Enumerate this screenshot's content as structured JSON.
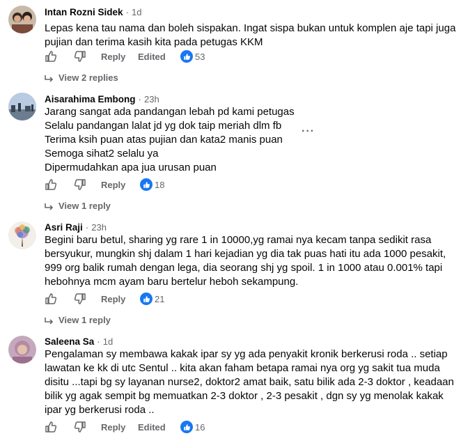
{
  "comments": [
    {
      "author": "Intan Rozni Sidek",
      "time": "1d",
      "lines": [
        "Lepas kena tau nama dan boleh sispakan. Ingat sispa bukan untuk komplen aje tapi juga",
        "pujian dan terima kasih kita pada petugas KKM"
      ],
      "reply_label": "Reply",
      "edited_label": "Edited",
      "like_count": "53",
      "view_replies": "View 2 replies"
    },
    {
      "author": "Aisarahima Embong",
      "time": "23h",
      "lines": [
        "Jarang sangat ada pandangan lebah pd kami petugas",
        "Selalu pandangan lalat jd yg dok taip meriah dlm fb",
        "Terima ksih puan atas pujian dan kata2 manis puan",
        "Semoga sihat2 selalu ya",
        "Dipermudahkan apa jua urusan puan"
      ],
      "reply_label": "Reply",
      "like_count": "18",
      "view_replies": "View 1 reply",
      "more_label": "···"
    },
    {
      "author": "Asri Raji",
      "time": "23h",
      "lines": [
        "Begini baru betul, sharing yg rare 1 in 10000,yg ramai nya kecam tanpa sedikit rasa",
        "bersyukur, mungkin shj dalam 1 hari kejadian yg dia tak puas hati itu ada 1000 pesakit,",
        "999 org balik rumah dengan lega, dia seorang shj yg spoil. 1 in 1000 atau 0.001% tapi",
        "hebohnya mcm ayam baru bertelur heboh sekampung."
      ],
      "reply_label": "Reply",
      "like_count": "21",
      "view_replies": "View 1 reply"
    },
    {
      "author": "Saleena Sa",
      "time": "1d",
      "lines": [
        "Pengalaman sy membawa kakak ipar sy yg ada penyakit kronik berkerusi roda .. setiap",
        "lawatan ke kk di utc Sentul .. kita akan faham betapa ramai nya org yg sakit tua muda",
        "disitu ...tapi bg sy layanan nurse2, doktor2 amat baik, satu bilik ada 2-3 doktor , keadaan",
        "bilik yg agak sempit bg memuatkan 2-3 doktor , 2-3 pesakit , dgn sy yg menolak kakak",
        "ipar yg berkerusi roda .."
      ],
      "reply_label": "Reply",
      "edited_label": "Edited",
      "like_count": "16"
    }
  ],
  "colors": {
    "like_blue": "#1877f2",
    "secondary_text": "#65676b",
    "primary_text": "#050505"
  }
}
